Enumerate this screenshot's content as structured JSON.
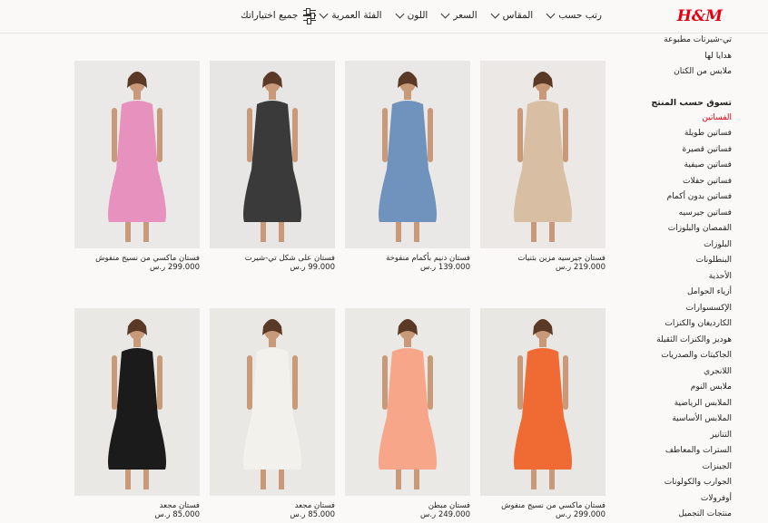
{
  "header": {
    "logo": "H&M",
    "filters": [
      {
        "label": "رتب حسب"
      },
      {
        "label": "المقاس"
      },
      {
        "label": "السعر"
      },
      {
        "label": "اللون"
      },
      {
        "label": "الفئة العمرية"
      }
    ],
    "all_filters_label": "جميع اختياراتك",
    "all_filters_icon": "sliders-icon"
  },
  "sidebar": {
    "links_top": [
      "تي-شيرتات مطبوعة",
      "هدايا لها",
      "ملابس من الكتان"
    ],
    "heading": "تسوق حسب المنتج",
    "links": [
      "الفساتين",
      "فساتين طويلة",
      "فساتين قصيرة",
      "فساتين صيفية",
      "فساتين حفلات",
      "فساتين بدون أكمام",
      "فساتين جيرسيه",
      "القمصان والبلوزات",
      "البلوزات",
      "البنطلونات",
      "الأحذية",
      "أزياء الحوامل",
      "الإكسسوارات",
      "الكارديغان والكنزات",
      "هوديز والكنزات الثقيلة",
      "الجاكيتات والصدريات",
      "اللانجري",
      "ملابس النوم",
      "الملابس الرياضية",
      "الملابس الأساسية",
      "التنانير",
      "السترات والمعاطف",
      "الجينزات",
      "الجوارب والكولونات",
      "أوفرولات",
      "منتجات التجميل"
    ],
    "active_index": 0,
    "accent_color": "#e50010"
  },
  "products": [
    {
      "name": "فستان جيرسيه مزين بثنيات",
      "price": "219.000 ر.س",
      "bg": "#ebe8e5",
      "dress": "#d8bfa3"
    },
    {
      "name": "فستان دنيم بأكمام منفوخة",
      "price": "139.000 ر.س",
      "bg": "#e9e8e6",
      "dress": "#6f93bd"
    },
    {
      "name": "فستان على شكل تي-شيرت",
      "price": "99.000 ر.س",
      "bg": "#e8e6e4",
      "dress": "#3a3a3a"
    },
    {
      "name": "فستان ماكسي من نسيج منفوش",
      "price": "299.000 ر.س",
      "bg": "#ebe9e7",
      "dress": "#e791be"
    },
    {
      "name": "فستان ماكسي من نسيج منفوش",
      "price": "299.000 ر.س",
      "bg": "#e9e7e4",
      "dress": "#f06a34"
    },
    {
      "name": "فستان مبطن",
      "price": "249.000 ر.س",
      "bg": "#ebe9e6",
      "dress": "#f7a689"
    },
    {
      "name": "فستان مجعد",
      "price": "85.000 ر.س",
      "bg": "#eae8e5",
      "dress": "#f3f1ec"
    },
    {
      "name": "فستان مجعد",
      "price": "85.000 ر.س",
      "bg": "#eae8e5",
      "dress": "#1b1b1b"
    }
  ]
}
